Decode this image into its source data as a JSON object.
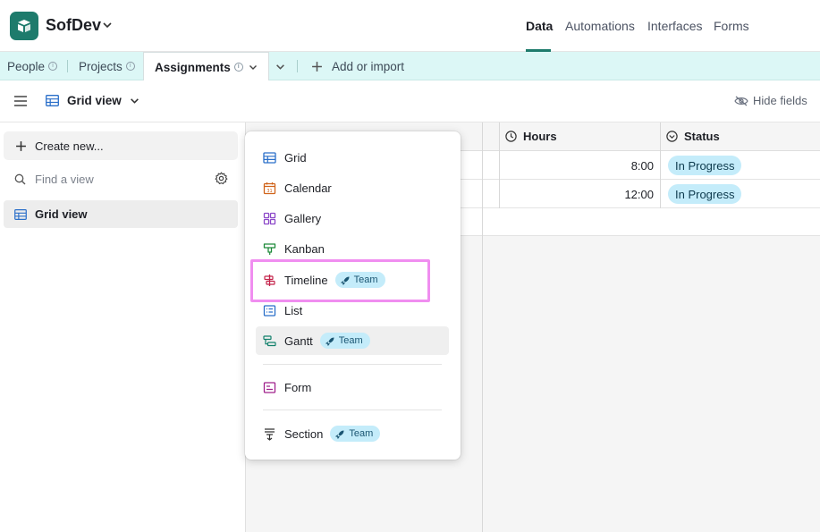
{
  "header": {
    "base_name": "SofDev",
    "nav": [
      "Data",
      "Automations",
      "Interfaces",
      "Forms"
    ],
    "active_nav": "Data"
  },
  "tabs": {
    "items": [
      "People",
      "Projects",
      "Assignments"
    ],
    "active": "Assignments",
    "add_label": "Add or import"
  },
  "viewbar": {
    "view_name": "Grid view",
    "hide_fields": "Hide fields"
  },
  "sidebar": {
    "create_label": "Create new...",
    "find_placeholder": "Find a view",
    "views": [
      "Grid view"
    ]
  },
  "grid": {
    "columns": [
      "Hours",
      "Status"
    ],
    "rows": [
      {
        "hours": "8:00",
        "status": "In Progress"
      },
      {
        "hours": "12:00",
        "status": "In Progress"
      }
    ]
  },
  "menu": {
    "items": [
      {
        "label": "Grid",
        "icon": "grid-icon"
      },
      {
        "label": "Calendar",
        "icon": "calendar-icon"
      },
      {
        "label": "Gallery",
        "icon": "gallery-icon"
      },
      {
        "label": "Kanban",
        "icon": "kanban-icon"
      },
      {
        "label": "Timeline",
        "icon": "timeline-icon",
        "badge": "Team"
      },
      {
        "label": "List",
        "icon": "list-icon"
      },
      {
        "label": "Gantt",
        "icon": "gantt-icon",
        "badge": "Team"
      },
      {
        "label": "Form",
        "icon": "form-icon"
      },
      {
        "label": "Section",
        "icon": "section-icon",
        "badge": "Team"
      }
    ]
  },
  "colors": {
    "brand": "#1e7b6c",
    "tabbar": "#dcf7f6",
    "pill": "#c4ecfa",
    "highlight": "#f08ef0"
  }
}
